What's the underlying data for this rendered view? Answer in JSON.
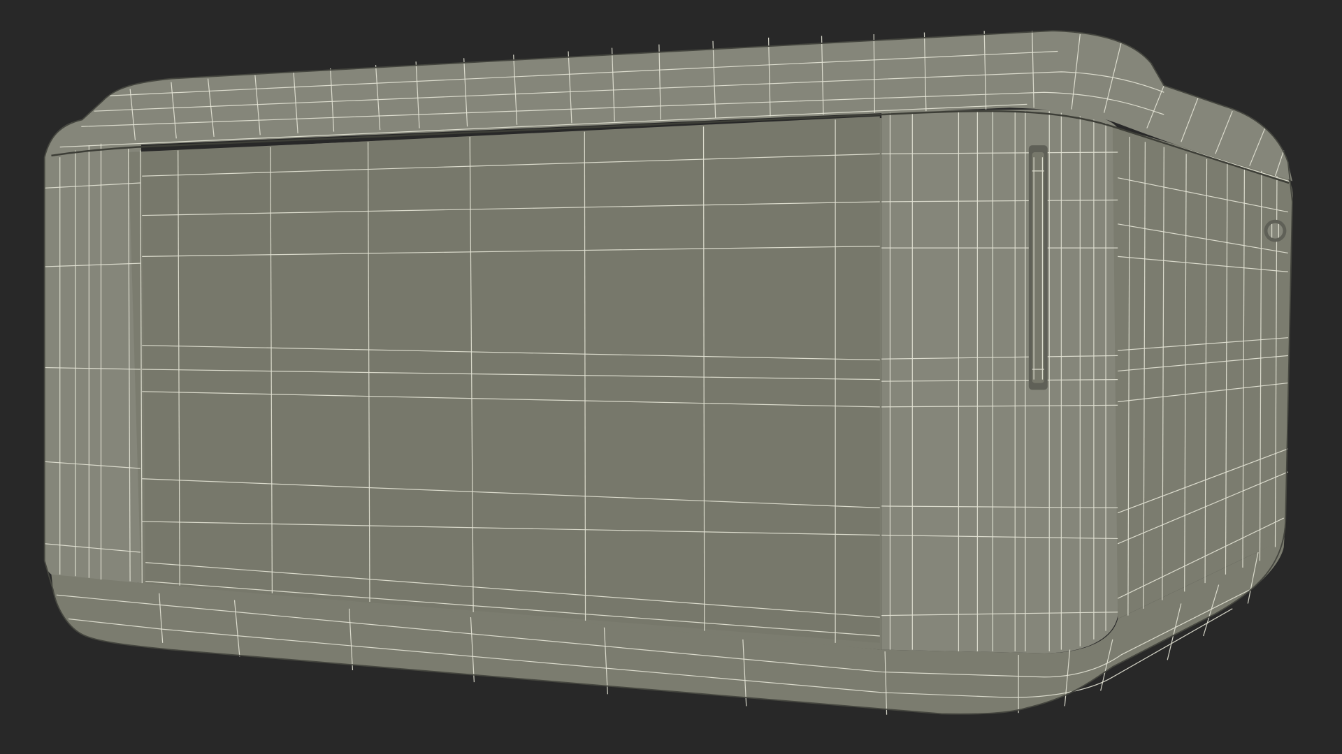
{
  "scene": {
    "subject": "hot-tub-wireframe-model",
    "colors": {
      "background": "#282828",
      "surface": "#7b7c6f",
      "surface_light": "#84857a",
      "surface_dark": "#6f7065",
      "wire": "#e6e6d8",
      "wire_dim": "#c9c9bb",
      "edge": "#3a3a35"
    }
  }
}
